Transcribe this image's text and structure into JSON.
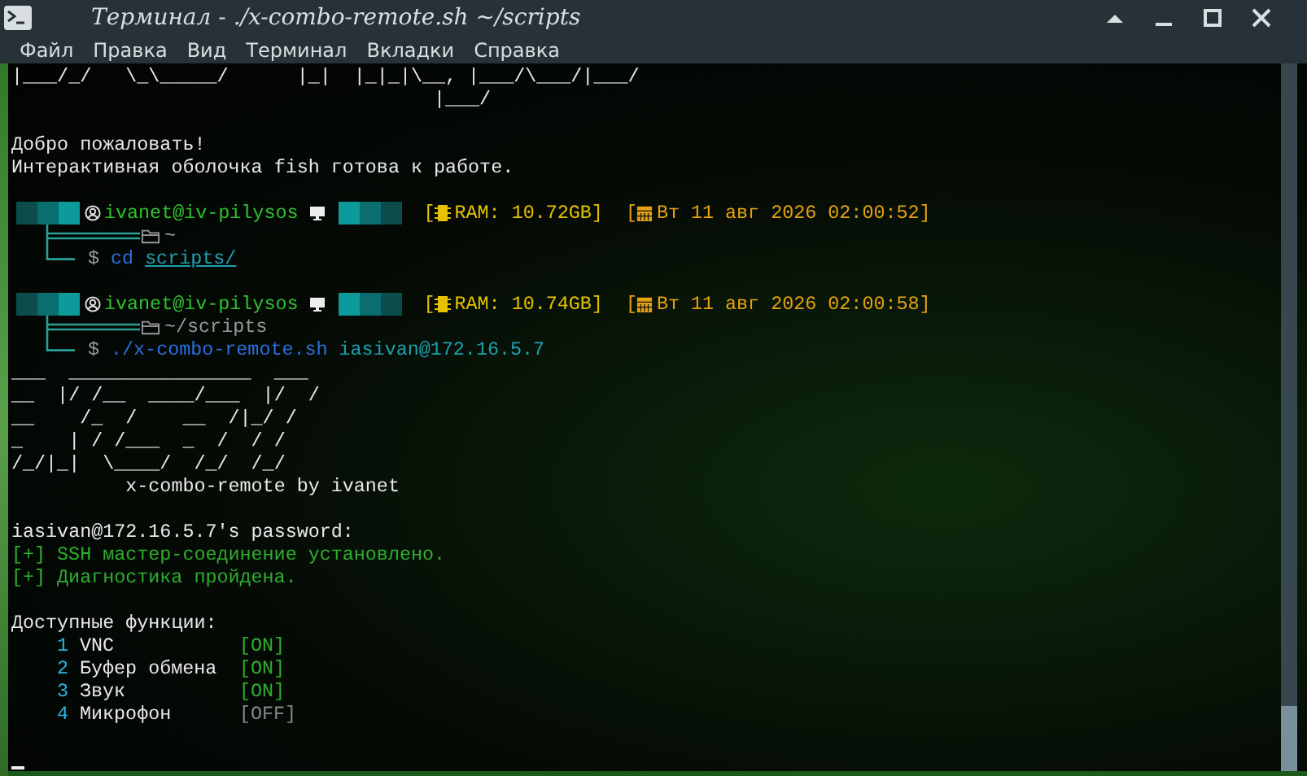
{
  "window": {
    "title": "Терминал - ./x-combo-remote.sh  ~/scripts"
  },
  "menu": [
    "Файл",
    "Правка",
    "Вид",
    "Терминал",
    "Вкладки",
    "Справка"
  ],
  "terminal": {
    "lines": [
      {
        "kind": "art",
        "text": "|___/_/   \\_\\_____/      |_|  |_|_|\\__, |___/\\___/|___/"
      },
      {
        "kind": "art",
        "text": "                                     |___/"
      },
      {
        "kind": "blank"
      },
      {
        "kind": "text",
        "text": "Добро пожаловать!"
      },
      {
        "kind": "text",
        "text": "Интерактивная оболочка fish готова к работе."
      },
      {
        "kind": "blank"
      },
      {
        "kind": "prompt",
        "user": "ivanet@iv-pilysos",
        "ram": "RAM: 10.72GB]",
        "datetime": "Вт 11 авг 2026 02:00:52]",
        "open_bracket": "[",
        "cwd": "~",
        "dollar": "$",
        "command": "cd",
        "args": [
          {
            "text": "scripts/",
            "underlined": true
          }
        ]
      },
      {
        "kind": "blank"
      },
      {
        "kind": "prompt",
        "user": "ivanet@iv-pilysos",
        "ram": "RAM: 10.74GB]",
        "datetime": "Вт 11 авг 2026 02:00:58]",
        "open_bracket": "[",
        "cwd": "~/scripts",
        "dollar": "$",
        "command": "./x-combo-remote.sh",
        "args": [
          {
            "text": "iasivan@172.16.5.7",
            "underlined": false
          }
        ]
      },
      {
        "kind": "art",
        "text": "___  ________________  ___"
      },
      {
        "kind": "art",
        "text": "__  |/ /__  ____/___  |/  /"
      },
      {
        "kind": "art",
        "text": "__    /_  /    __  /|_/ /"
      },
      {
        "kind": "art",
        "text": "_    | / /___  _  /  / /"
      },
      {
        "kind": "art",
        "text": "/_/|_|  \\____/  /_/  /_/"
      },
      {
        "kind": "text",
        "text": "          x-combo-remote by ivanet"
      },
      {
        "kind": "blank"
      },
      {
        "kind": "text",
        "text": "iasivan@172.16.5.7's password:"
      },
      {
        "kind": "ok",
        "mark": "[+]",
        "text": "SSH мастер-соединение установлено."
      },
      {
        "kind": "ok",
        "mark": "[+]",
        "text": "Диагностика пройдена."
      },
      {
        "kind": "blank"
      },
      {
        "kind": "text",
        "text": "Доступные функции:"
      },
      {
        "kind": "feature",
        "number": "1",
        "name": "VNC",
        "status": "[ON]",
        "on": true
      },
      {
        "kind": "feature",
        "number": "2",
        "name": "Буфер обмена",
        "status": "[ON]",
        "on": true
      },
      {
        "kind": "feature",
        "number": "3",
        "name": "Звук",
        "status": "[ON]",
        "on": true
      },
      {
        "kind": "feature",
        "number": "4",
        "name": "Микрофон",
        "status": "[OFF]",
        "on": false
      },
      {
        "kind": "blank"
      },
      {
        "kind": "cursor"
      }
    ]
  }
}
